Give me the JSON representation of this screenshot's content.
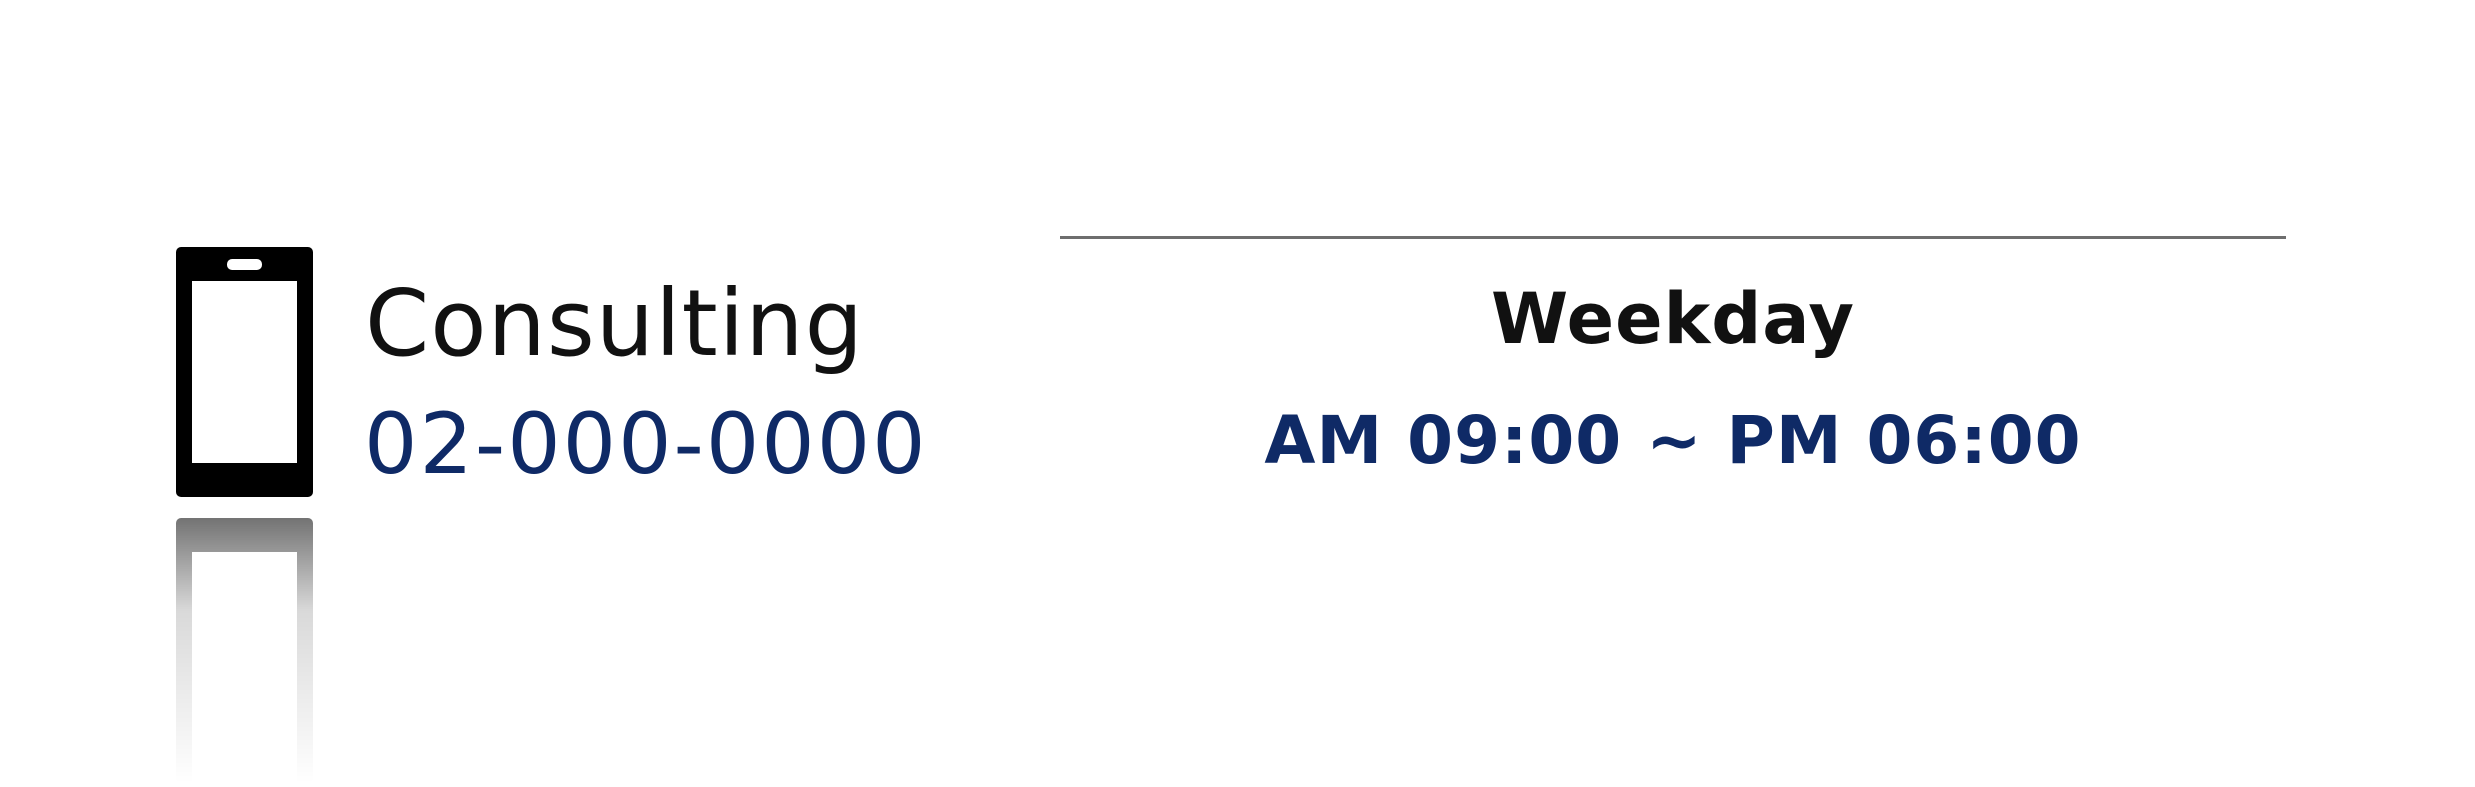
{
  "consulting": {
    "label": "Consulting",
    "phone_number": "02-000-0000",
    "icon": "mobile-phone-icon"
  },
  "hours": {
    "day_label": "Weekday",
    "time_range": "AM 09:00 ~ PM 06:00"
  },
  "colors": {
    "accent": "#0f2a66",
    "text": "#111111",
    "divider": "#6e6e6e"
  }
}
